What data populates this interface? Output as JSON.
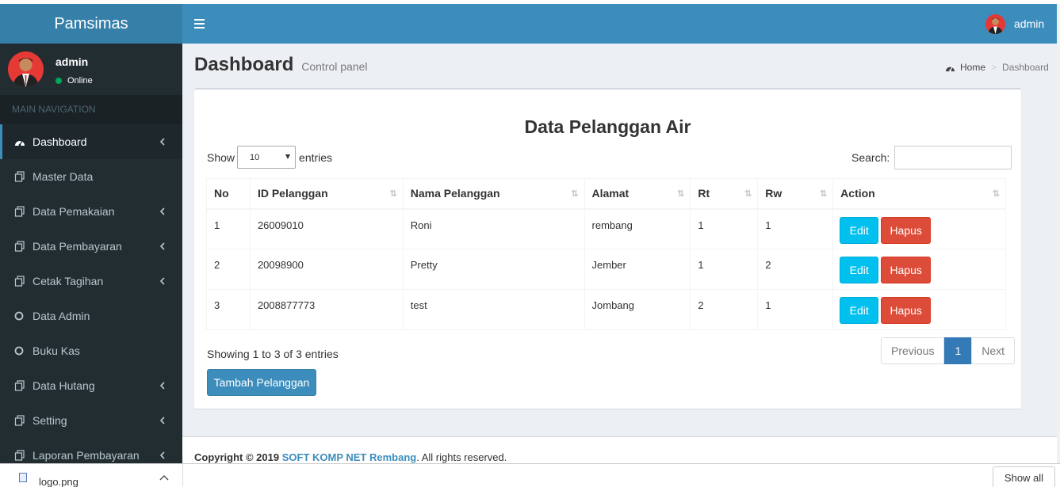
{
  "app": {
    "logo": "Pamsimas"
  },
  "user": {
    "name": "admin",
    "status": "Online"
  },
  "sidebar": {
    "header": "MAIN NAVIGATION",
    "items": [
      {
        "label": "Dashboard",
        "icon": "dashboard-icon",
        "chevron": true,
        "active": true
      },
      {
        "label": "Master Data",
        "icon": "files-icon",
        "chevron": false
      },
      {
        "label": "Data Pemakaian",
        "icon": "files-icon",
        "chevron": true
      },
      {
        "label": "Data Pembayaran",
        "icon": "files-icon",
        "chevron": true
      },
      {
        "label": "Cetak Tagihan",
        "icon": "files-icon",
        "chevron": true
      },
      {
        "label": "Data Admin",
        "icon": "circle-icon",
        "chevron": false
      },
      {
        "label": "Buku Kas",
        "icon": "circle-icon",
        "chevron": false
      },
      {
        "label": "Data Hutang",
        "icon": "files-icon",
        "chevron": true
      },
      {
        "label": "Setting",
        "icon": "files-icon",
        "chevron": true
      },
      {
        "label": "Laporan Pembayaran",
        "icon": "files-icon",
        "chevron": true
      }
    ]
  },
  "header": {
    "user_name": "admin"
  },
  "page": {
    "title": "Dashboard",
    "subtitle": "Control panel",
    "breadcrumb": {
      "home": "Home",
      "current": "Dashboard"
    }
  },
  "box": {
    "title": "Data Pelanggan Air",
    "show_label": "Show",
    "entries_value": "10",
    "entries_label": "entries",
    "search_label": "Search:",
    "columns": [
      "No",
      "ID Pelanggan",
      "Nama Pelanggan",
      "Alamat",
      "Rt",
      "Rw",
      "Action"
    ],
    "rows": [
      {
        "no": "1",
        "id": "26009010",
        "nama": "Roni",
        "alamat": "rembang",
        "rt": "1",
        "rw": "1"
      },
      {
        "no": "2",
        "id": "20098900",
        "nama": "Pretty",
        "alamat": "Jember",
        "rt": "1",
        "rw": "2"
      },
      {
        "no": "3",
        "id": "2008877773",
        "nama": "test",
        "alamat": "Jombang",
        "rt": "2",
        "rw": "1"
      }
    ],
    "edit_label": "Edit",
    "delete_label": "Hapus",
    "info": "Showing 1 to 3 of 3 entries",
    "pager": {
      "prev": "Previous",
      "current": "1",
      "next": "Next"
    },
    "add_label": "Tambah Pelanggan"
  },
  "footer": {
    "prefix": "Copyright © 2019 ",
    "company": "SOFT KOMP NET Rembang",
    "suffix": ". All rights reserved."
  },
  "downloads": {
    "file": "logo.png",
    "show_all": "Show all"
  },
  "colors": {
    "header": "#3c8dbc",
    "logo_bg": "#367fa9",
    "sidebar_bg": "#222d32",
    "edit": "#00c0ef",
    "delete": "#dd4b39",
    "online": "#00a65a"
  }
}
